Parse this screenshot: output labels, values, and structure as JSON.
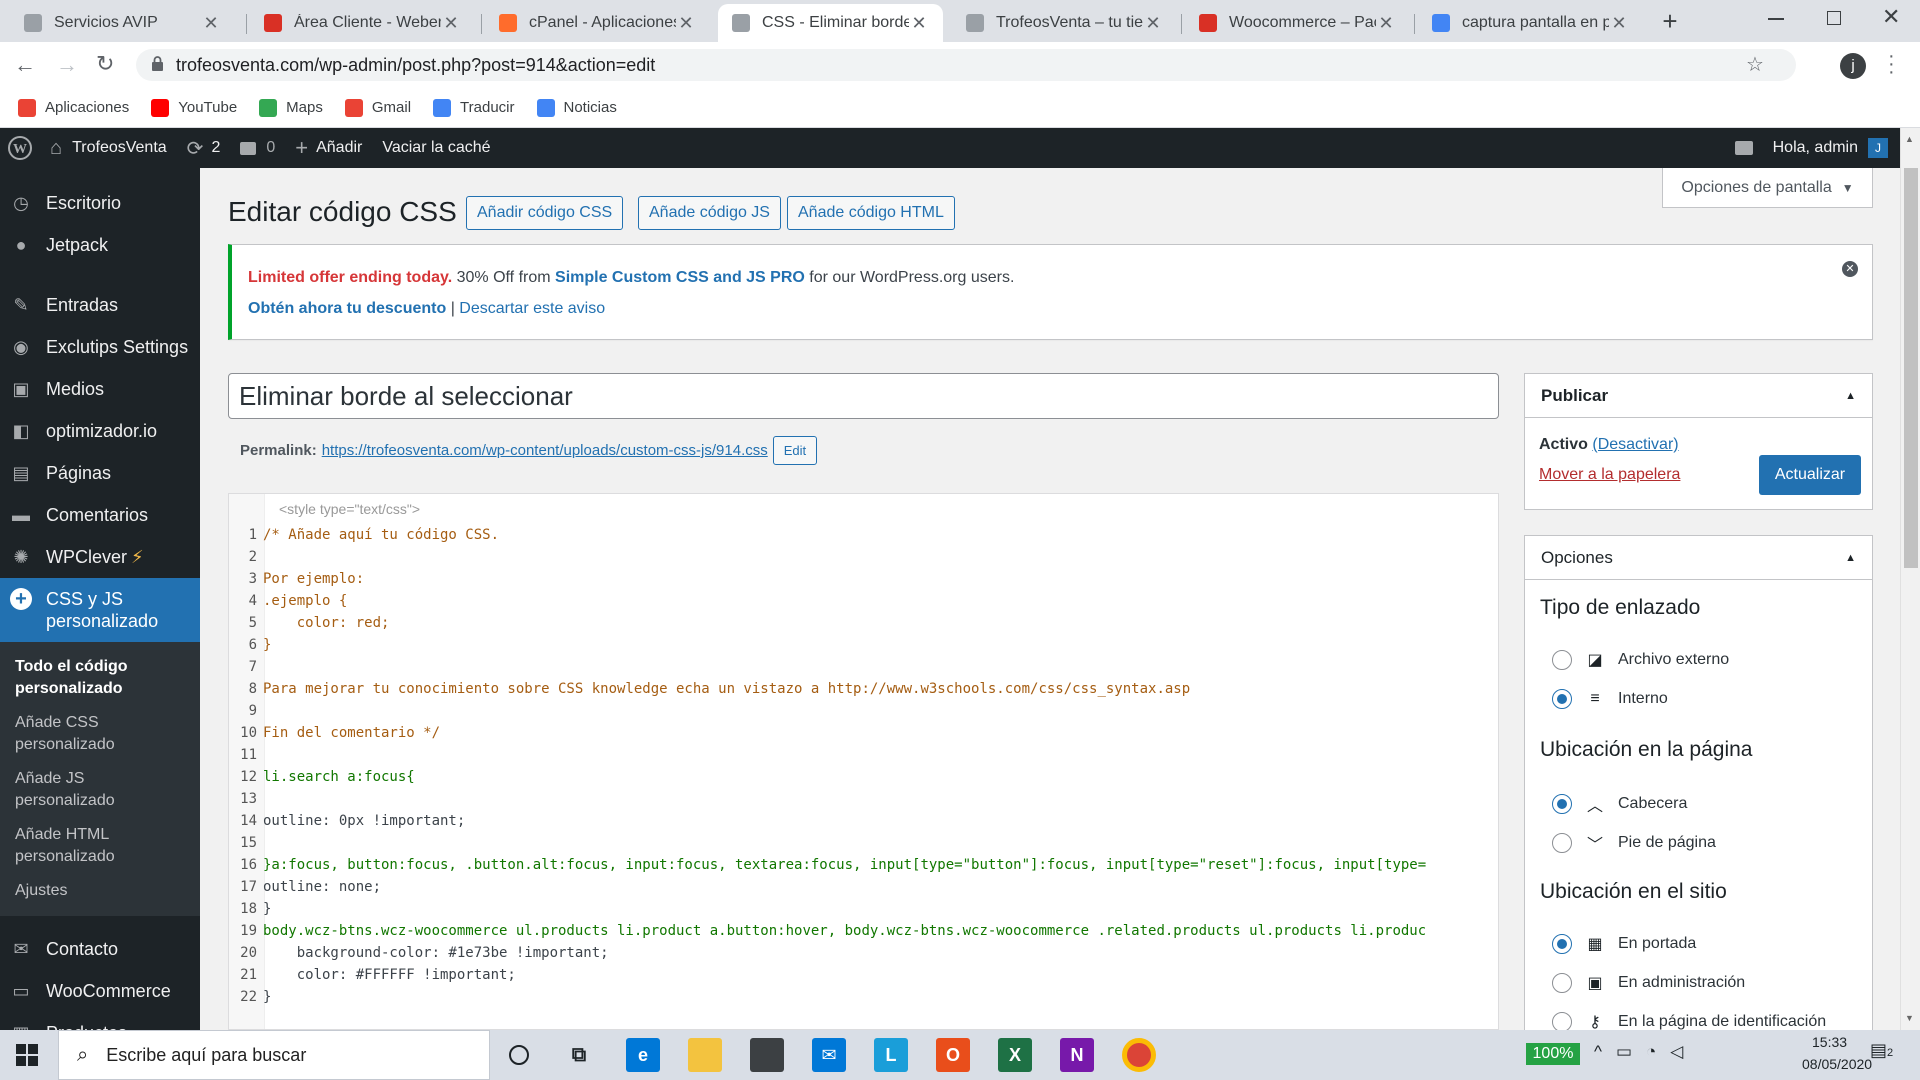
{
  "browser": {
    "tabs": [
      {
        "title": "Servicios AVIP",
        "icon": "page-icon",
        "color": "#9aa0a6"
      },
      {
        "title": "Área Cliente - Webemp",
        "icon": "webempresa-icon",
        "color": "#d93025"
      },
      {
        "title": "cPanel - Aplicaciones W",
        "icon": "cpanel-icon",
        "color": "#ff6c2c"
      },
      {
        "title": "CSS - Eliminar borde al",
        "icon": "trofeos-icon",
        "color": "#9aa0a6",
        "active": true
      },
      {
        "title": "TrofeosVenta – tu tienda",
        "icon": "trofeos-icon",
        "color": "#9aa0a6"
      },
      {
        "title": "Woocommerce – Pack",
        "icon": "webempresa-icon",
        "color": "#d93025"
      },
      {
        "title": "captura pantalla en por",
        "icon": "google-icon",
        "color": "#4285f4"
      }
    ],
    "new_tab": "+",
    "url": "trofeosventa.com/wp-admin/post.php?post=914&action=edit",
    "profile_initial": "j",
    "bookmarks": [
      {
        "label": "Aplicaciones",
        "icon": "apps-grid-icon",
        "color": "#ea4335"
      },
      {
        "label": "YouTube",
        "icon": "youtube-icon",
        "color": "#ff0000"
      },
      {
        "label": "Maps",
        "icon": "maps-icon",
        "color": "#34a853"
      },
      {
        "label": "Gmail",
        "icon": "gmail-icon",
        "color": "#ea4335"
      },
      {
        "label": "Traducir",
        "icon": "translate-icon",
        "color": "#4285f4"
      },
      {
        "label": "Noticias",
        "icon": "news-icon",
        "color": "#4285f4"
      }
    ]
  },
  "adminbar": {
    "site_name": "TrofeosVenta",
    "updates_count": "2",
    "comments_count": "0",
    "add_label": "Añadir",
    "cache_label": "Vaciar la caché",
    "greeting": "Hola, admin",
    "avatar_initial": "J"
  },
  "sidebar": {
    "items": [
      {
        "label": "Escritorio",
        "icon": "dashboard-icon"
      },
      {
        "label": "Jetpack",
        "icon": "jetpack-icon"
      },
      {
        "label": "Entradas",
        "icon": "pin-icon"
      },
      {
        "label": "Exclutips Settings",
        "icon": "settings-icon"
      },
      {
        "label": "Medios",
        "icon": "media-icon"
      },
      {
        "label": "optimizador.io",
        "icon": "optimizer-icon"
      },
      {
        "label": "Páginas",
        "icon": "pages-icon"
      },
      {
        "label": "Comentarios",
        "icon": "comment-icon"
      },
      {
        "label": "WPClever",
        "icon": "wpclever-icon",
        "badge": "⚡"
      },
      {
        "label": "CSS y JS personalizado",
        "icon": "plus-circle-icon",
        "current": true
      },
      {
        "label": "Contacto",
        "icon": "mail-icon"
      },
      {
        "label": "WooCommerce",
        "icon": "woo-icon"
      },
      {
        "label": "Productos",
        "icon": "products-icon"
      }
    ],
    "submenu": [
      {
        "label": "Todo el código personalizado",
        "current": true
      },
      {
        "label": "Añade CSS personalizado"
      },
      {
        "label": "Añade JS personalizado"
      },
      {
        "label": "Añade HTML personalizado"
      },
      {
        "label": "Ajustes"
      }
    ]
  },
  "page": {
    "title": "Editar código CSS",
    "buttons": [
      "Añadir código CSS",
      "Añade código JS",
      "Añade código HTML"
    ],
    "screen_options": "Opciones de pantalla",
    "notice": {
      "strong_red": "Limited offer ending today.",
      "text1": " 30% Off from ",
      "product": "Simple Custom CSS and JS PRO",
      "text2": " for our WordPress.org users.",
      "cta": "Obtén ahora tu descuento",
      "sep": " | ",
      "dismiss": "Descartar este aviso"
    },
    "post_title": "Eliminar borde al seleccionar",
    "permalink_label": "Permalink:",
    "permalink_url": "https://trofeosventa.com/wp-content/uploads/custom-css-js/914.css",
    "permalink_edit": "Edit",
    "editor_header": "<style type=\"text/css\">",
    "code_lines": [
      {
        "n": "1",
        "t": "/* Añade aquí tu código CSS.",
        "c": "cm"
      },
      {
        "n": "2",
        "t": "",
        "c": ""
      },
      {
        "n": "3",
        "t": "Por ejemplo:",
        "c": "cm"
      },
      {
        "n": "4",
        "t": ".ejemplo {",
        "c": "cm"
      },
      {
        "n": "5",
        "t": "    color: red;",
        "c": "cm"
      },
      {
        "n": "6",
        "t": "}",
        "c": "cm"
      },
      {
        "n": "7",
        "t": "",
        "c": ""
      },
      {
        "n": "8",
        "t": "Para mejorar tu conocimiento sobre CSS knowledge echa un vistazo a http://www.w3schools.com/css/css_syntax.asp",
        "c": "cm"
      },
      {
        "n": "9",
        "t": "",
        "c": ""
      },
      {
        "n": "10",
        "t": "Fin del comentario */",
        "c": "cm"
      },
      {
        "n": "11",
        "t": "",
        "c": ""
      },
      {
        "n": "12",
        "t": "li.search a:focus{",
        "c": "kw"
      },
      {
        "n": "13",
        "t": "",
        "c": ""
      },
      {
        "n": "14",
        "t": "outline: 0px !important;",
        "c": ""
      },
      {
        "n": "15",
        "t": "",
        "c": ""
      },
      {
        "n": "16",
        "t": "}a:focus, button:focus, .button.alt:focus, input:focus, textarea:focus, input[type=\"button\"]:focus, input[type=\"reset\"]:focus, input[type=",
        "c": "kw"
      },
      {
        "n": "17",
        "t": "outline: none;",
        "c": ""
      },
      {
        "n": "18",
        "t": "}",
        "c": ""
      },
      {
        "n": "19",
        "t": "body.wcz-btns.wcz-woocommerce ul.products li.product a.button:hover, body.wcz-btns.wcz-woocommerce .related.products ul.products li.produc",
        "c": "kw"
      },
      {
        "n": "20",
        "t": "    background-color: #1e73be !important;",
        "c": ""
      },
      {
        "n": "21",
        "t": "    color: #FFFFFF !important;",
        "c": ""
      },
      {
        "n": "22",
        "t": "}",
        "c": ""
      }
    ]
  },
  "publish": {
    "title": "Publicar",
    "status_label": "Activo",
    "deactivate": "(Desactivar)",
    "trash": "Mover a la papelera",
    "update": "Actualizar"
  },
  "options": {
    "title": "Opciones",
    "sections": [
      {
        "heading": "Tipo de enlazado",
        "items": [
          {
            "label": "Archivo externo",
            "icon": "file-code-icon",
            "checked": false
          },
          {
            "label": "Interno",
            "icon": "lines-icon",
            "checked": true
          }
        ]
      },
      {
        "heading": "Ubicación en la página",
        "items": [
          {
            "label": "Cabecera",
            "icon": "chevron-up-icon",
            "checked": true
          },
          {
            "label": "Pie de página",
            "icon": "chevron-down-icon",
            "checked": false
          }
        ]
      },
      {
        "heading": "Ubicación en el sitio",
        "items": [
          {
            "label": "En portada",
            "icon": "layout-icon",
            "checked": true
          },
          {
            "label": "En administración",
            "icon": "admin-icon",
            "checked": false
          },
          {
            "label": "En la página de identificación",
            "icon": "key-icon",
            "checked": false
          }
        ]
      }
    ]
  },
  "taskbar": {
    "search_placeholder": "Escribe aquí para buscar",
    "battery": "100%",
    "time": "15:33",
    "date": "08/05/2020",
    "notifications": "2"
  }
}
